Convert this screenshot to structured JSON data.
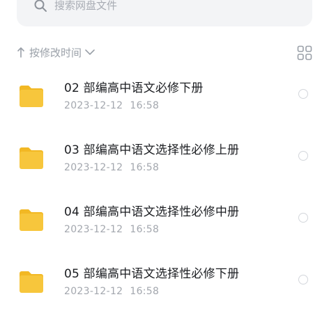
{
  "search": {
    "placeholder": "搜索网盘文件",
    "icon": "search-icon"
  },
  "sort": {
    "label": "按修改时间",
    "direction_icon": "arrow-up-icon",
    "caret_icon": "chevron-down-icon"
  },
  "view_toggle": {
    "icon": "grid-icon"
  },
  "files": [
    {
      "name": "02 部编高中语文必修下册",
      "date": "2023-12-12",
      "time": "16:58",
      "icon": "folder-icon"
    },
    {
      "name": "03 部编高中语文选择性必修上册",
      "date": "2023-12-12",
      "time": "16:58",
      "icon": "folder-icon"
    },
    {
      "name": "04 部编高中语文选择性必修中册",
      "date": "2023-12-12",
      "time": "16:58",
      "icon": "folder-icon"
    },
    {
      "name": "05 部编高中语文选择性必修下册",
      "date": "2023-12-12",
      "time": "16:58",
      "icon": "folder-icon"
    }
  ],
  "colors": {
    "folder": "#f7c63c",
    "folder_tab": "#f2b824",
    "search_bg": "#f3f4f6",
    "muted_text": "#a3a7ae"
  }
}
